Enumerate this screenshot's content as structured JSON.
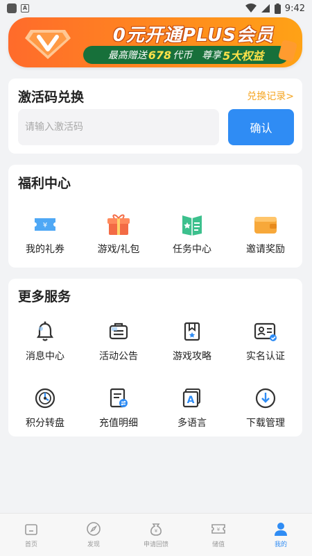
{
  "status_bar": {
    "time": "9:42",
    "left_icons": [
      "app-square-icon",
      "a-notification-icon"
    ],
    "right_icons": [
      "wifi-icon",
      "signal-icon",
      "battery-icon"
    ]
  },
  "banner": {
    "title": "0元开通PLUS会员",
    "line_prefix": "最高赠送",
    "coin_amount": "678",
    "coin_unit": "代币",
    "line_mid": "尊享",
    "benefit_count": "5大权益",
    "colors": {
      "bg_start": "#ff6b2b",
      "bg_end": "#ffa216",
      "pill": "#17703a",
      "highlight": "#ffe24a"
    }
  },
  "redeem": {
    "title": "激活码兑换",
    "history_link": "兑换记录>",
    "input_placeholder": "请输入激活码",
    "input_value": "",
    "confirm_label": "确认",
    "accent": "#2f8cf4"
  },
  "welfare": {
    "title": "福利中心",
    "items": [
      {
        "label": "我的礼券",
        "icon": "coupon-icon"
      },
      {
        "label": "游戏/礼包",
        "icon": "gift-icon"
      },
      {
        "label": "任务中心",
        "icon": "task-book-icon"
      },
      {
        "label": "邀请奖励",
        "icon": "wallet-icon"
      }
    ]
  },
  "services": {
    "title": "更多服务",
    "items": [
      {
        "label": "消息中心",
        "icon": "bell-icon"
      },
      {
        "label": "活动公告",
        "icon": "announcement-icon"
      },
      {
        "label": "游戏攻略",
        "icon": "guide-book-icon"
      },
      {
        "label": "实名认证",
        "icon": "id-card-icon"
      },
      {
        "label": "积分转盘",
        "icon": "wheel-icon"
      },
      {
        "label": "充值明细",
        "icon": "recharge-detail-icon"
      },
      {
        "label": "多语言",
        "icon": "language-icon"
      },
      {
        "label": "下载管理",
        "icon": "download-icon"
      }
    ]
  },
  "bottom_nav": {
    "items": [
      {
        "label": "首页",
        "icon": "home-icon",
        "active": false
      },
      {
        "label": "发现",
        "icon": "compass-icon",
        "active": false
      },
      {
        "label": "申请回馈",
        "icon": "money-bag-icon",
        "active": false
      },
      {
        "label": "储值",
        "icon": "ticket-icon",
        "active": false
      },
      {
        "label": "我的",
        "icon": "person-icon",
        "active": true
      }
    ]
  }
}
